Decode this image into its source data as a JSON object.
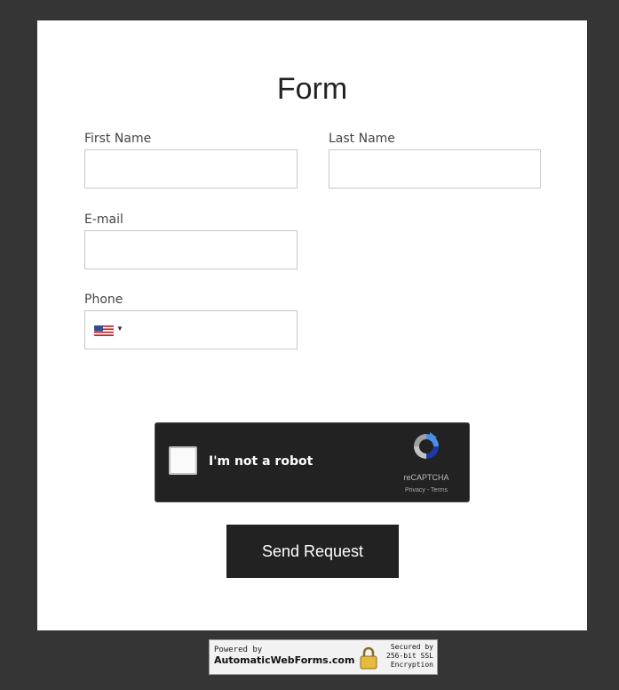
{
  "form": {
    "title": "Form",
    "first_name": {
      "label": "First Name",
      "value": ""
    },
    "last_name": {
      "label": "Last Name",
      "value": ""
    },
    "email": {
      "label": "E-mail",
      "value": ""
    },
    "phone": {
      "label": "Phone",
      "value": "",
      "country_flag": "us-flag-icon"
    },
    "submit_label": "Send Request"
  },
  "recaptcha": {
    "label": "I'm not a robot",
    "brand": "reCAPTCHA",
    "privacy": "Privacy",
    "separator": " - ",
    "terms": "Terms",
    "checked": false
  },
  "footer_badge": {
    "powered_by": "Powered by",
    "site": "AutomaticWebForms.com",
    "secured_line1": "Secured by",
    "secured_line2": "256-bit SSL",
    "secured_line3": "Encryption"
  },
  "colors": {
    "page_background": "#353535",
    "card_background": "#ffffff",
    "button_background": "#222222",
    "recaptcha_background": "#222222"
  }
}
